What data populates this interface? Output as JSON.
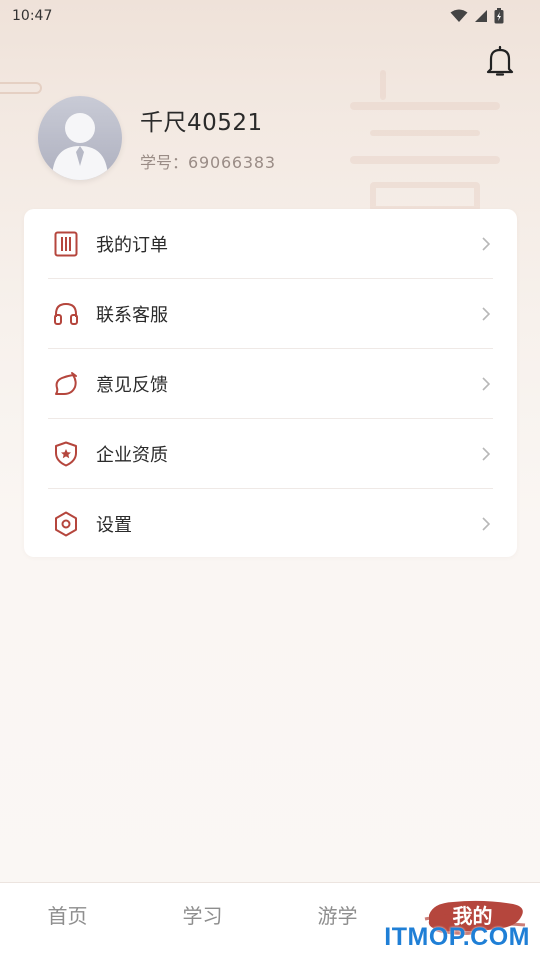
{
  "status_bar": {
    "time": "10:47"
  },
  "header": {
    "bell_icon": "bell-icon"
  },
  "profile": {
    "username": "千尺40521",
    "student_id_label": "学号：",
    "student_id": "69066383"
  },
  "menu": {
    "items": [
      {
        "label": "我的订单",
        "icon": "order-list-icon"
      },
      {
        "label": "联系客服",
        "icon": "headset-icon"
      },
      {
        "label": "意见反馈",
        "icon": "feedback-bubble-icon"
      },
      {
        "label": "企业资质",
        "icon": "shield-star-icon"
      },
      {
        "label": "设置",
        "icon": "settings-hexagon-icon"
      }
    ]
  },
  "bottom_nav": {
    "items": [
      {
        "label": "首页",
        "active": false
      },
      {
        "label": "学习",
        "active": false
      },
      {
        "label": "游学",
        "active": false
      },
      {
        "label": "我的",
        "active": true
      }
    ]
  },
  "colors": {
    "accent": "#b5463d",
    "icon": "#b5463d",
    "watermark": "#1f7fd6"
  },
  "watermark": "ITMOP.COM"
}
